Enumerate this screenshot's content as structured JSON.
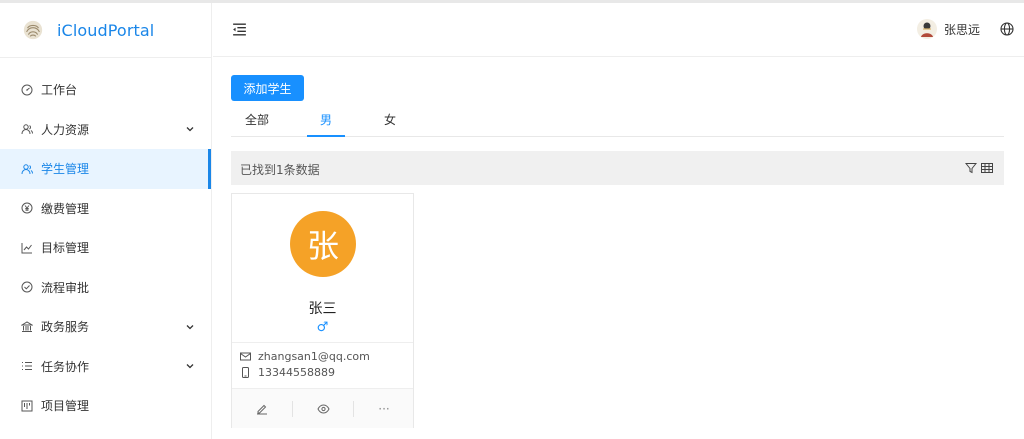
{
  "app": {
    "title": "iCloudPortal",
    "logo_icon": "fingerprint-icon"
  },
  "sidebar": {
    "items": [
      {
        "label": "工作台",
        "icon": "dashboard-icon",
        "expandable": false,
        "active": false
      },
      {
        "label": "人力资源",
        "icon": "users-icon",
        "expandable": true,
        "active": false
      },
      {
        "label": "学生管理",
        "icon": "users-icon",
        "expandable": false,
        "active": true
      },
      {
        "label": "缴费管理",
        "icon": "yen-circle-icon",
        "expandable": false,
        "active": false
      },
      {
        "label": "目标管理",
        "icon": "line-chart-icon",
        "expandable": false,
        "active": false
      },
      {
        "label": "流程审批",
        "icon": "check-circle-icon",
        "expandable": false,
        "active": false
      },
      {
        "label": "政务服务",
        "icon": "bank-icon",
        "expandable": true,
        "active": false
      },
      {
        "label": "任务协作",
        "icon": "list-icon",
        "expandable": true,
        "active": false
      },
      {
        "label": "项目管理",
        "icon": "project-icon",
        "expandable": false,
        "active": false
      }
    ]
  },
  "header": {
    "menu_fold_icon": "menu-fold-icon",
    "user_name": "张思远",
    "globe_icon": "globe-icon"
  },
  "main": {
    "add_button": "添加学生",
    "tabs": [
      {
        "label": "全部",
        "active": false
      },
      {
        "label": "男",
        "active": true
      },
      {
        "label": "女",
        "active": false
      }
    ],
    "found_text": "已找到1条数据",
    "card": {
      "avatar_char": "张",
      "name": "张三",
      "gender_symbol": "♂",
      "email": "zhangsan1@qq.com",
      "phone": "13344558889",
      "more_label": "···"
    }
  },
  "colors": {
    "primary": "#1890ff",
    "logo_text": "#1a86e8",
    "active_bg": "#e8f4ff",
    "avatar_bg": "#f5a227"
  }
}
